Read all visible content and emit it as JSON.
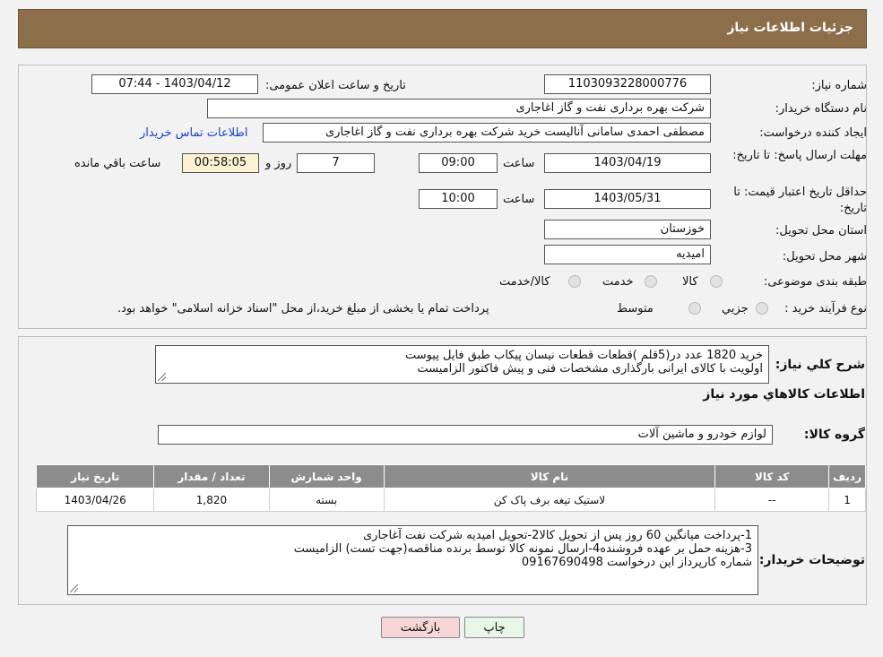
{
  "header": {
    "title": "جزئیات اطلاعات نیاز"
  },
  "fields": {
    "need_number_label": "شماره نیاز:",
    "need_number": "1103093228000776",
    "announce_label": "تاریخ و ساعت اعلان عمومی:",
    "announce_value": "1403/04/12 - 07:44",
    "buyer_org_label": "نام دستگاه خریدار:",
    "buyer_org": "شرکت بهره برداری نفت و گاز اغاجاری",
    "creator_label": "ایجاد کننده درخواست:",
    "creator": "مصطفی احمدی سامانی آنالیست خرید شرکت بهره برداری نفت و گاز اغاجاری",
    "contact_link": "اطلاعات تماس خریدار",
    "deadline_label": "مهلت ارسال پاسخ: تا تاریخ:",
    "deadline_date": "1403/04/19",
    "time_label": "ساعت",
    "deadline_time": "09:00",
    "days_value": "7",
    "days_label": "روز و",
    "remaining_time": "00:58:05",
    "remaining_label": "ساعت باقي مانده",
    "validity_label": "حداقل تاریخ اعتبار قیمت: تا تاریخ:",
    "validity_date": "1403/05/31",
    "validity_time": "10:00",
    "province_label": "استان محل تحویل:",
    "province": "خوزستان",
    "city_label": "شهر محل تحویل:",
    "city": "امیدیه",
    "category_label": "طبقه بندی موضوعی:",
    "category_options": [
      "کالا",
      "خدمت",
      "کالا/خدمت"
    ],
    "process_label": "نوع فرآیند خرید :",
    "process_options": [
      "جزیي",
      "متوسط"
    ],
    "process_note": "پرداخت تمام یا بخشی از مبلغ خرید،از محل \"اسناد خزانه اسلامی\" خواهد بود."
  },
  "description": {
    "label": "شرح کلي نیاز:",
    "line1": "خرید 1820 عدد در(5قلم )قطعات قطعات نیسان پیکاب طبق فایل پیوست",
    "line2": "اولویت با کالای ایرانی بارگذاری مشخصات فنی و پیش فاکتور الزامیست"
  },
  "goods": {
    "section_title": "اطلاعات کالاهاي مورد نیاز",
    "group_label": "گروه کالا:",
    "group_value": "لوازم خودرو و ماشین آلات",
    "columns": [
      "ردیف",
      "کد کالا",
      "نام کالا",
      "واحد شمارش",
      "تعداد / مقدار",
      "تاریخ نیاز"
    ],
    "rows": [
      [
        "1",
        "--",
        "لاستیک تیغه برف پاک کن",
        "بسته",
        "1,820",
        "1403/04/26"
      ]
    ]
  },
  "buyer_notes": {
    "label": "توضیحات خریدار:",
    "line1": "1-پرداخت میانگین 60 روز پس از تحویل کالا2-تحویل امیدیه شرکت نفت آغاجاری",
    "line2": "3-هزینه حمل بر عهده فروشنده4-ارسال نمونه کالا توسط برنده مناقصه(جهت تست) الزامیست",
    "line3": "شماره کارپرداز این درخواست 09167690498"
  },
  "buttons": {
    "print": "چاپ",
    "back": "بازگشت"
  },
  "colors": {
    "header_bg": "#8d6e4a",
    "table_header_bg": "#8c8c8c",
    "back_button_bg": "#f6d6d6",
    "link": "#1a3fd6"
  }
}
